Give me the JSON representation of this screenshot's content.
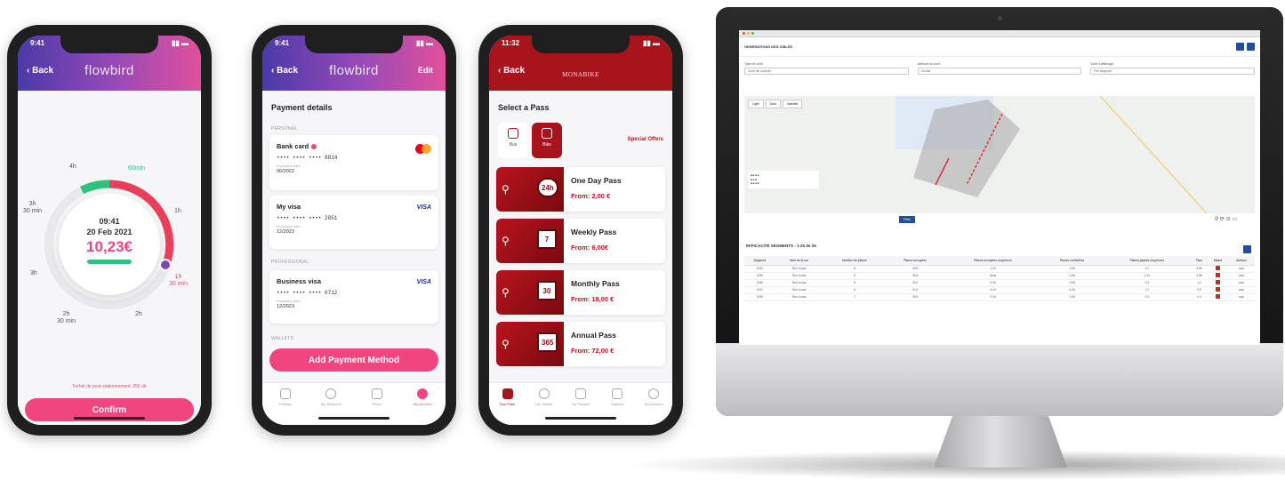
{
  "phone1": {
    "time": "9:41",
    "back": "Back",
    "logo": "flowbird",
    "labels": {
      "l4h": "4h",
      "l60": "60min",
      "l3h30": "3h\n30 min",
      "l1h": "1h",
      "l3h": "3h",
      "l1h30": "1h\n30 min",
      "l2h30": "2h\n30 min",
      "l2h": "2h"
    },
    "clock_time": "09:41",
    "date": "20 Feb 2021",
    "price": "10,23€",
    "notice": "Forfait de post-stationnement: 35€ dû",
    "confirm": "Confirm"
  },
  "phone2": {
    "time": "9:41",
    "back": "Back",
    "logo": "flowbird",
    "edit": "Edit",
    "title": "Payment details",
    "section_personal": "PERSONAL",
    "section_professional": "PROFESSIONAL",
    "section_wallets": "WALLETS",
    "cards": [
      {
        "name": "Bank card",
        "number": "•••• •••• •••• 8814",
        "exp_label": "Expiration date",
        "exp": "06/2022"
      },
      {
        "name": "My visa",
        "brand": "VISA",
        "number": "•••• •••• •••• 2851",
        "exp_label": "Expiration date",
        "exp": "12/2023"
      },
      {
        "name": "Business visa",
        "brand": "VISA",
        "number": "•••• •••• •••• 0712",
        "exp_label": "Expiration date",
        "exp": "12/2023"
      }
    ],
    "add_button": "Add Payment Method",
    "tabs": [
      "Parking",
      "My Sessions",
      "Fines",
      "My Account"
    ]
  },
  "phone3": {
    "time": "11:32",
    "back": "Back",
    "logo": "MONABIKE",
    "title": "Select a Pass",
    "toggle_bus": "Bus",
    "toggle_bike": "Bike",
    "special_offers": "Special Offers",
    "passes": [
      {
        "badge": "24h",
        "name": "One Day Pass",
        "price": "From: 2,00 €"
      },
      {
        "badge": "7",
        "name": "Weekly Pass",
        "price": "From: 6,00€"
      },
      {
        "badge": "30",
        "name": "Monthly Pass",
        "price": "From: 18,00 €"
      },
      {
        "badge": "365",
        "name": "Annual Pass",
        "price": "From: 72,00 €"
      }
    ],
    "tabs": [
      "Buy Pass",
      "My Tickets",
      "My Passes",
      "Stations",
      "My Account"
    ]
  },
  "desktop": {
    "page_title": "GENERATIONS DES CIBLES",
    "filters": [
      {
        "label": "Type de zone",
        "value": "Zone de contrôle"
      },
      {
        "label": "Attribuer la zone",
        "value": "Choisir"
      },
      {
        "label": "Zone d'affichage",
        "value": "Par segment"
      }
    ],
    "map_tabs": [
      "Light",
      "Dark",
      "Satellite"
    ],
    "filter_button": "Filtre",
    "table_title": "EFFICACITÉ SEGMENTS - 1-25 de 26",
    "columns": [
      "Segment",
      "Nom de la rue",
      "Nombre de places",
      "Places occupées",
      "Places occupées moyennes",
      "Places contrôlées",
      "Places payées moyennes",
      "Taux",
      "Statut",
      "Actions"
    ],
    "rows": [
      [
        "1234",
        "Rue Lucas",
        "8",
        "42%",
        "1,24",
        "0,96",
        "0,7",
        "0,55",
        "",
        "●●●"
      ],
      [
        "1235",
        "Rue Lucas",
        "8",
        "38,5",
        "Anna",
        "0,36",
        "1,24",
        "0,88",
        "",
        "●●●"
      ],
      [
        "1236",
        "Rue Lucas",
        "8",
        "32,5",
        "0,34",
        "0,36",
        "0,3",
        "1,2",
        "",
        "●●●"
      ],
      [
        "1237",
        "Rue Lucas",
        "8",
        "32,5",
        "4,24",
        "4,36",
        "3,7",
        "0,9",
        "",
        "●●●"
      ],
      [
        "1238",
        "Rue Lucas",
        "7",
        "26,5",
        "0,34",
        "0,36",
        "0,3",
        "0,4",
        "",
        "●●●"
      ]
    ]
  },
  "colors": {
    "pink": "#f0457e",
    "red": "#a8141c",
    "blue": "#1f4f9a",
    "green": "#2ec27e"
  }
}
